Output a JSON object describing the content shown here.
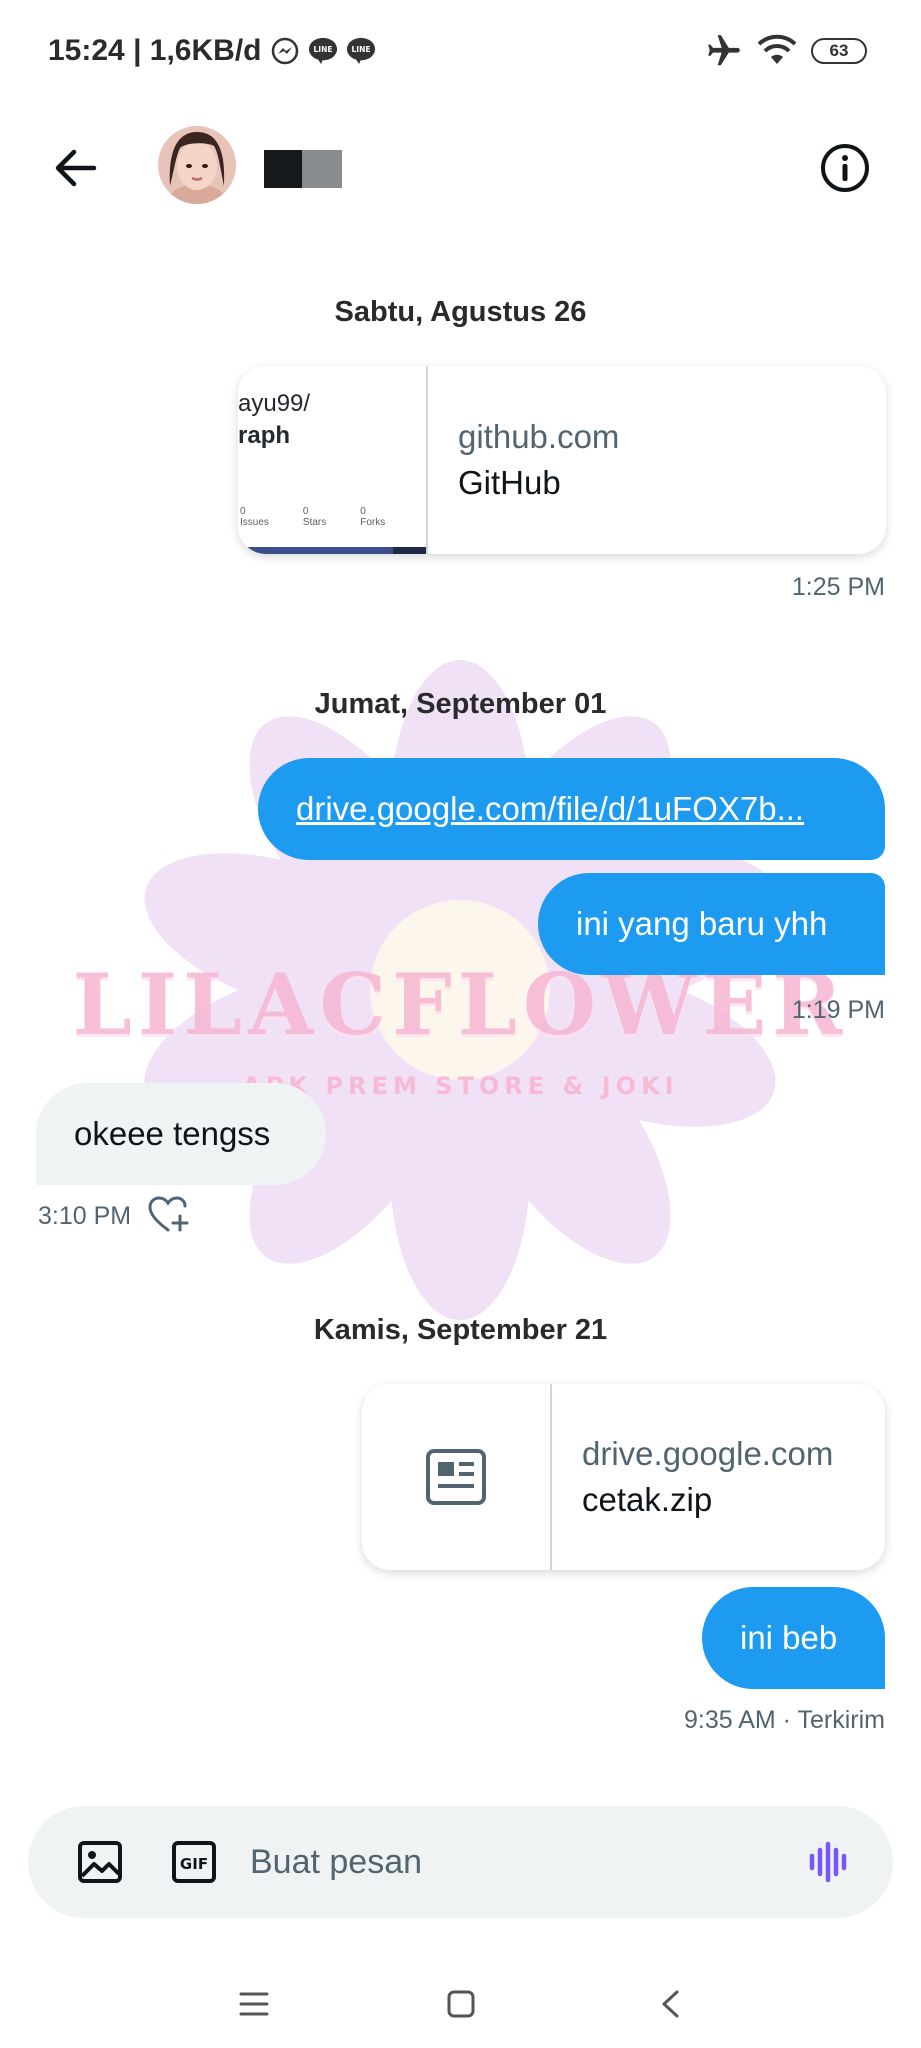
{
  "status_bar": {
    "time_speed": "15:24 | 1,6KB/d",
    "battery": "63",
    "icons": [
      "messenger-icon",
      "line-icon",
      "line-icon",
      "airplane-icon",
      "wifi-icon",
      "battery-icon"
    ]
  },
  "header": {
    "icons": [
      "back-arrow-icon",
      "info-icon"
    ]
  },
  "watermark": {
    "title": "LILACFLOWER",
    "subtitle": "APK PREM STORE & JOKI"
  },
  "messages": {
    "date1": "Sabtu, Agustus 26",
    "card1": {
      "thumb_user": "ayu99/",
      "thumb_repo": "raph",
      "thumb_stats": [
        "0",
        "0",
        "0"
      ],
      "thumb_stat_labels": [
        "Issues",
        "Stars",
        "Forks"
      ],
      "domain": "github.com",
      "title": "GitHub"
    },
    "time1": "1:25 PM",
    "date2": "Jumat, September 01",
    "msg_link": "drive.google.com/file/d/1uFOX7b...",
    "msg2": "ini yang baru yhh",
    "time2": "1:19 PM",
    "recv1": "okeee tengss",
    "time3": "3:10 PM",
    "date3": "Kamis, September 21",
    "card2": {
      "domain": "drive.google.com",
      "title": "cetak.zip"
    },
    "msg3": "ini beb",
    "time4": "9:35 AM · Terkirim"
  },
  "composer": {
    "placeholder": "Buat pesan",
    "gif_label": "GIF"
  },
  "colors": {
    "accent": "#1d9bf0",
    "received_bg": "#eff3f4",
    "secondary_text": "#536471",
    "voice_icon": "#7856ff"
  }
}
